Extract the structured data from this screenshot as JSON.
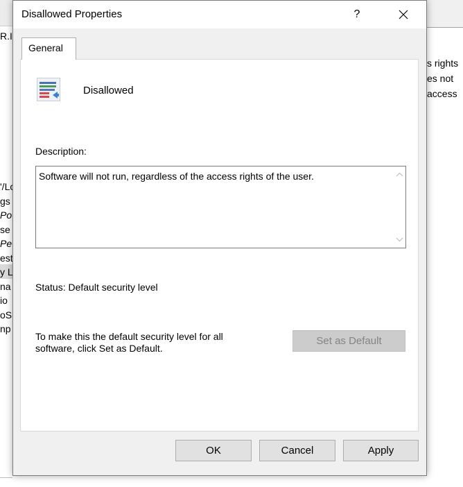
{
  "background": {
    "left_top_text": "R.I",
    "left_items": [
      "'/Lo",
      "gs",
      "Po",
      "se",
      "Pe",
      "est",
      "y L",
      "na",
      "io",
      "oS",
      "np"
    ],
    "right_lines": [
      "s rights",
      "es not",
      "access"
    ]
  },
  "dialog": {
    "title": "Disallowed Properties",
    "help_label": "?",
    "close_icon": "close-icon",
    "tab_label": "General",
    "rule_icon": "rule-list-icon",
    "rule_name": "Disallowed",
    "description_label": "Description:",
    "description_text": "Software will not run, regardless of the access rights of the user.",
    "status_text": "Status:  Default security level",
    "default_hint": "To make this the default security level for all software, click Set as Default.",
    "set_default_label": "Set as Default",
    "ok_label": "OK",
    "cancel_label": "Cancel",
    "apply_label": "Apply"
  }
}
